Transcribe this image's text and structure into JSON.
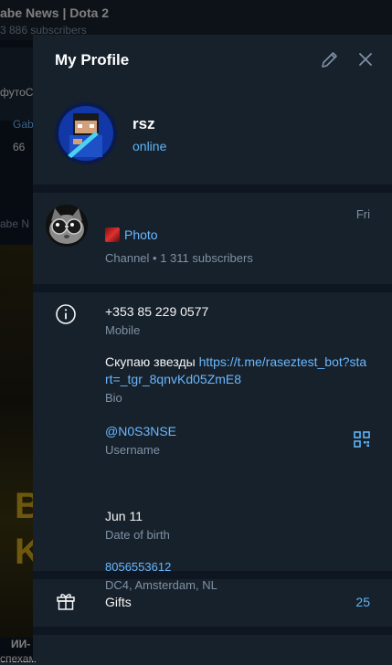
{
  "background_chat": {
    "title": "abe News | Dota 2",
    "subscribers": "3 886 subscribers",
    "snippet_1": "футоС",
    "snippet_2": "Gab",
    "reactions": "66",
    "snippet_3": "abe N",
    "big_letter_1": "B",
    "big_letter_2": "K",
    "snippet_4": "ИИ-",
    "snippet_5": "спехам"
  },
  "panel": {
    "title": "My Profile",
    "edit_icon": "pencil-icon",
    "close_icon": "close-icon"
  },
  "user": {
    "name": "rsz",
    "status": "online"
  },
  "channel": {
    "day": "Fri",
    "last_post": "Photo",
    "meta": "Channel • 1 311 subscribers"
  },
  "info": {
    "phone": "+353 85 229 0577",
    "phone_label": "Mobile",
    "bio_text": "Скупаю звезды ",
    "bio_link": "https://t.me/raseztest_bot?start=_tgr_8qnvKd05ZmE8",
    "bio_label": "Bio",
    "username": "@N0S3NSE",
    "username_label": "Username",
    "birthday": "Jun 11",
    "birthday_label": "Date of birth",
    "business_phone": "8056553612",
    "location": "DC4, Amsterdam, NL"
  },
  "gifts": {
    "label": "Gifts",
    "count": "25"
  },
  "colors": {
    "accent": "#5eb5f7",
    "link": "#6ab7ff",
    "panel_bg": "#17212b",
    "separator": "#0e1621",
    "secondary_text": "#7f91a4"
  }
}
